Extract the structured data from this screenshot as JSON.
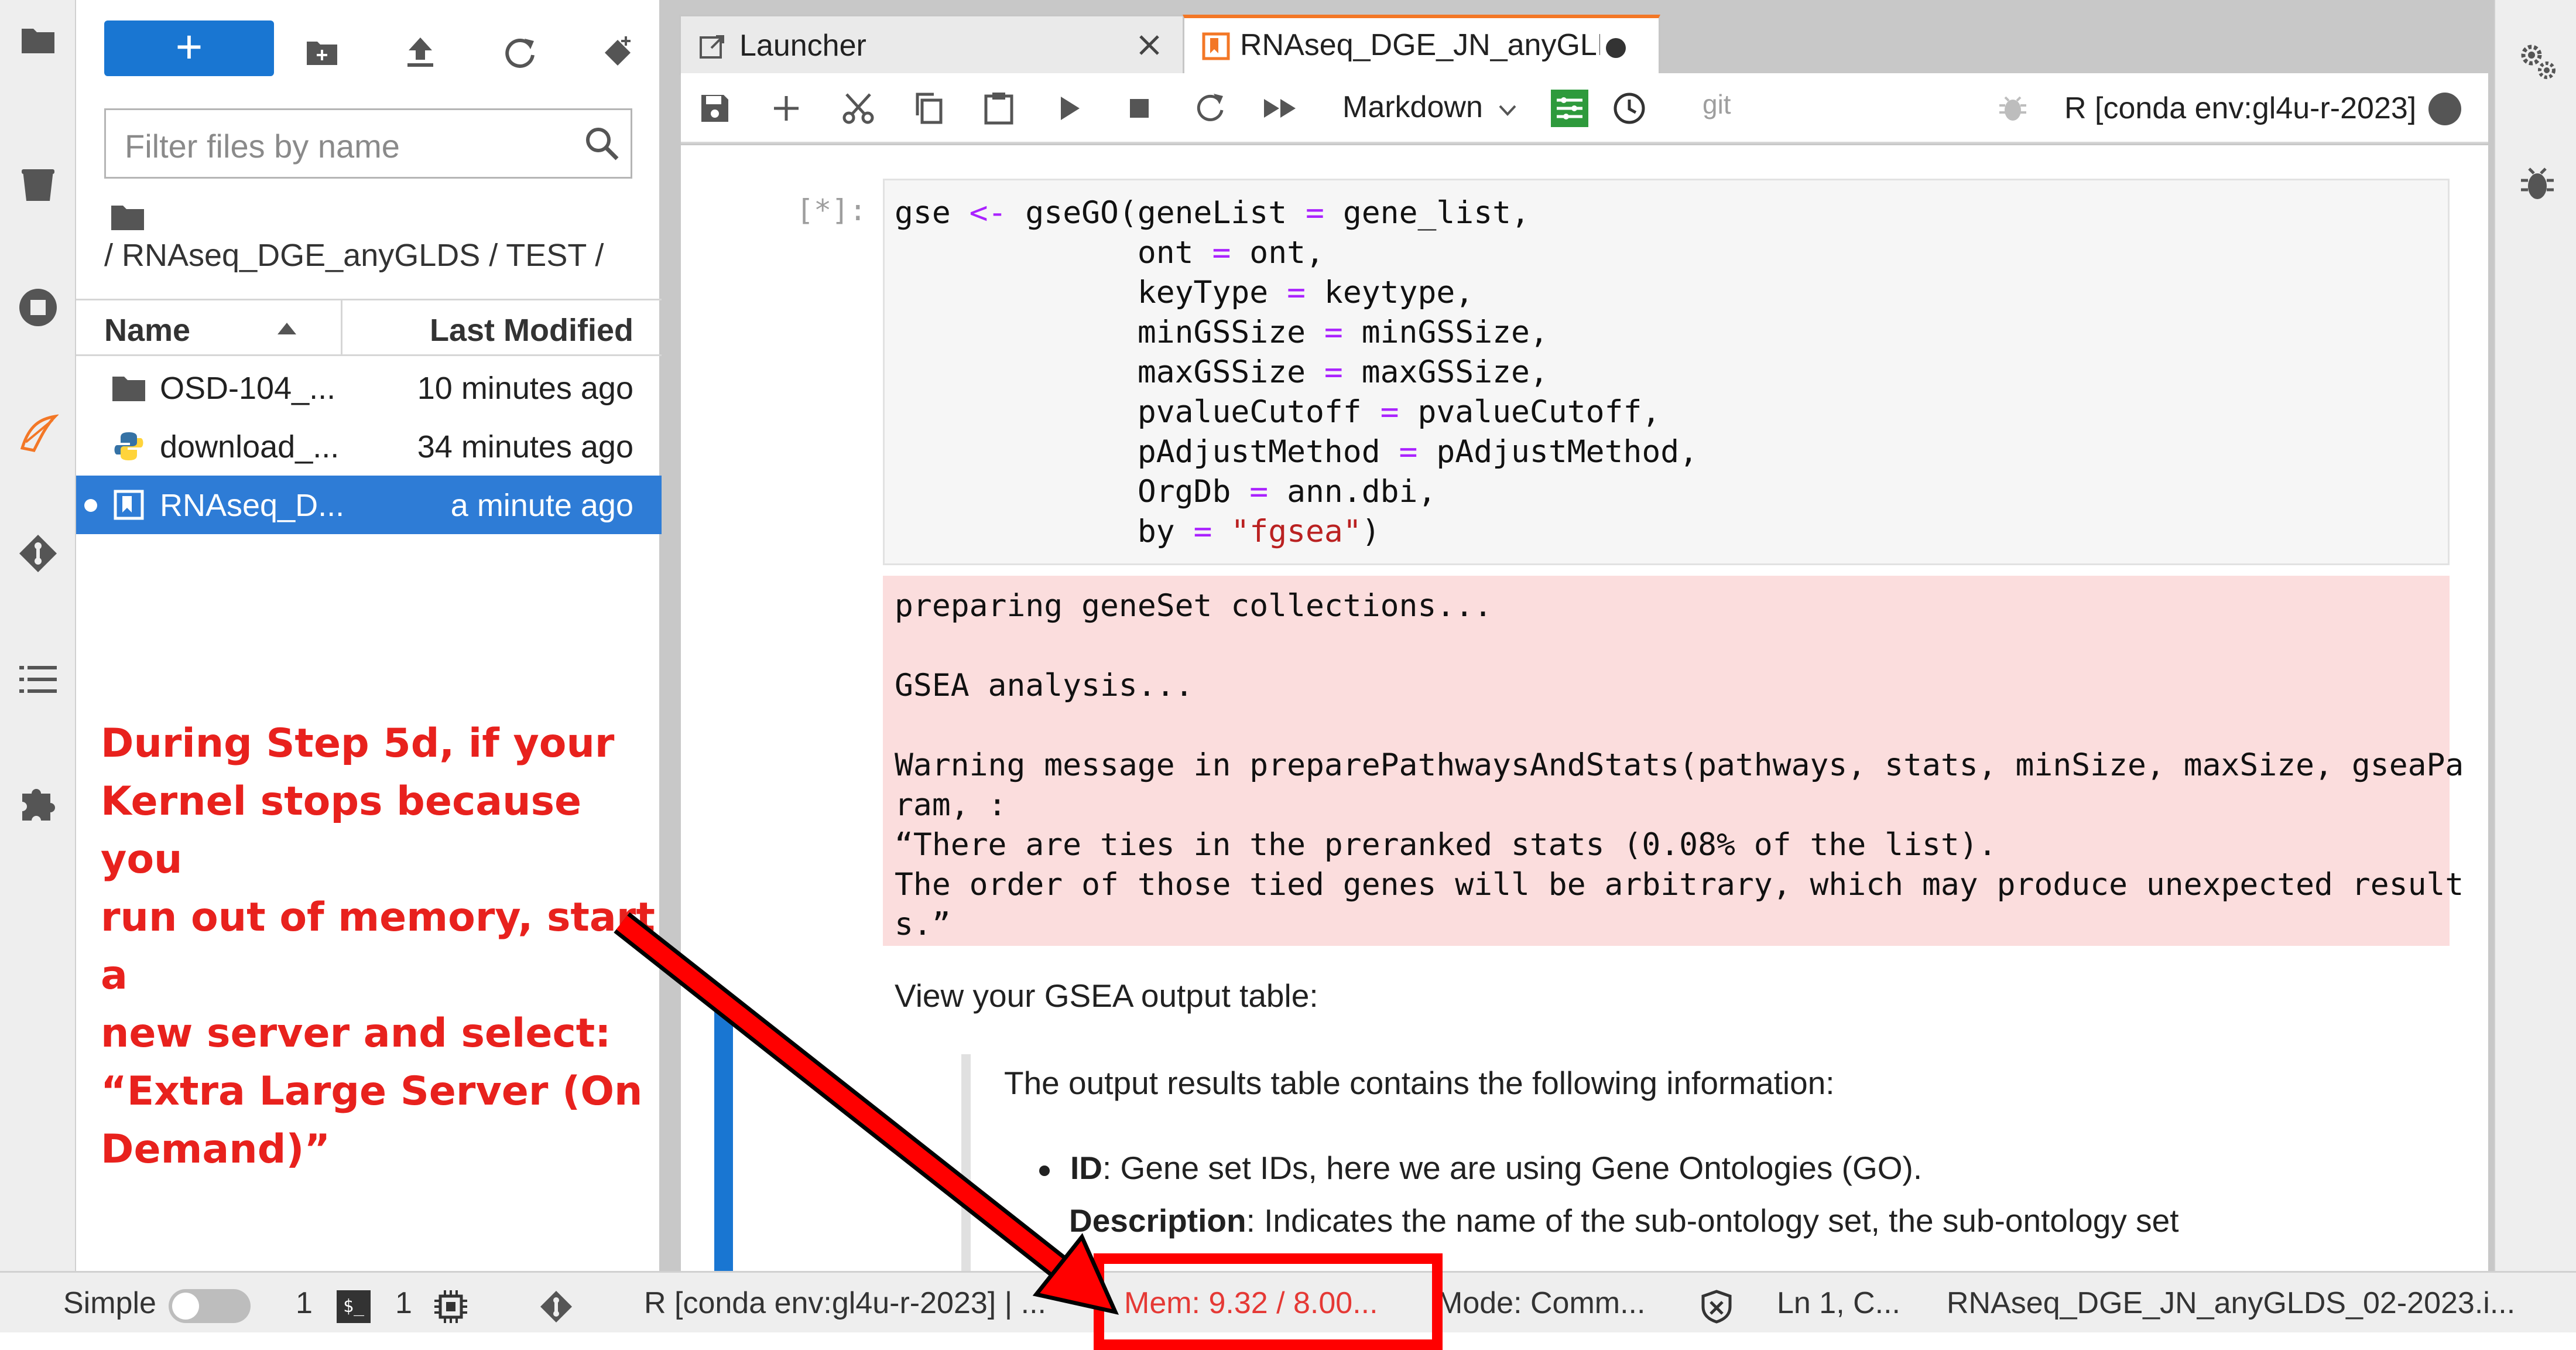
{
  "activity_bar": {
    "icons": [
      "folder-icon",
      "trash-icon",
      "stop-circle-icon",
      "kernel-logo-icon",
      "git-icon",
      "list-icon",
      "puzzle-icon"
    ]
  },
  "file_browser": {
    "new_label": "+",
    "filter_placeholder": "Filter files by name",
    "breadcrumb": "/ RNAseq_DGE_anyGLDS / TEST /",
    "columns": {
      "name": "Name",
      "modified": "Last Modified"
    },
    "files": [
      {
        "name": "OSD-104_...",
        "modified": "10 minutes ago",
        "icon": "folder-icon"
      },
      {
        "name": "download_...",
        "modified": "34 minutes ago",
        "icon": "python-icon"
      },
      {
        "name": "RNAseq_D...",
        "modified": "a minute ago",
        "icon": "notebook-icon",
        "selected": true
      }
    ]
  },
  "callout": {
    "lines": [
      "During Step 5d, if your",
      "Kernel stops because you",
      "run out of memory, start a",
      "new server and select:",
      "“Extra Large Server (On",
      "Demand)”"
    ],
    "color": "#e8211d"
  },
  "tabs": [
    {
      "label": "Launcher",
      "active": false
    },
    {
      "label": "RNAseq_DGE_JN_anyGLDS",
      "active": true
    }
  ],
  "toolbar": {
    "cell_type": "Markdown",
    "git_label": "git",
    "kernel_name": "R [conda env:gl4u-r-2023]"
  },
  "notebook": {
    "prompt": "[*]:",
    "code_lines": [
      {
        "pre": "gse ",
        "op": "<-",
        "post": " gseGO(geneList ",
        "op2": "=",
        "post2": " gene_list,"
      },
      {
        "pre": "             ont ",
        "op": "=",
        "post": " ont,"
      },
      {
        "pre": "             keyType ",
        "op": "=",
        "post": " keytype,"
      },
      {
        "pre": "             minGSSize ",
        "op": "=",
        "post": " minGSSize,"
      },
      {
        "pre": "             maxGSSize ",
        "op": "=",
        "post": " maxGSSize,"
      },
      {
        "pre": "             pvalueCutoff ",
        "op": "=",
        "post": " pvalueCutoff,"
      },
      {
        "pre": "             pAdjustMethod ",
        "op": "=",
        "post": " pAdjustMethod,"
      },
      {
        "pre": "             OrgDb ",
        "op": "=",
        "post": " ann.dbi,"
      },
      {
        "pre": "             by ",
        "op": "=",
        "post": " ",
        "str": "\"fgsea\"",
        "post2": ")"
      }
    ],
    "output_lines": [
      "preparing geneSet collections...",
      "",
      "GSEA analysis...",
      "",
      "Warning message in preparePathwaysAndStats(pathways, stats, minSize, maxSize, gseaPa",
      "ram, :",
      "“There are ties in the preranked stats (0.08% of the list).",
      "The order of those tied genes will be arbitrary, which may produce unexpected result",
      "s.”"
    ],
    "markdown_text": "View your GSEA output table:",
    "quote_text": "The output results table contains the following information:",
    "bullet_term": "ID",
    "bullet_text": ": Gene set IDs, here we are using Gene Ontologies (GO).",
    "desc_term": "Description",
    "desc_text": ": Indicates the name of the sub-ontology set, the sub-ontology set"
  },
  "status_bar": {
    "mode_label": "Simple",
    "terminals_count": "1",
    "kernels_count": "1",
    "kernel_status": "R [conda env:gl4u-r-2023] | ...",
    "memory": "Mem: 9.32 / 8.00...",
    "mode": "Mode: Comm...",
    "cursor": "Ln 1, C...",
    "filename": "RNAseq_DGE_JN_anyGLDS_02-2023.i..."
  },
  "annotation": {
    "arrow_color": "#ff0000",
    "box_color": "#ff0000"
  }
}
